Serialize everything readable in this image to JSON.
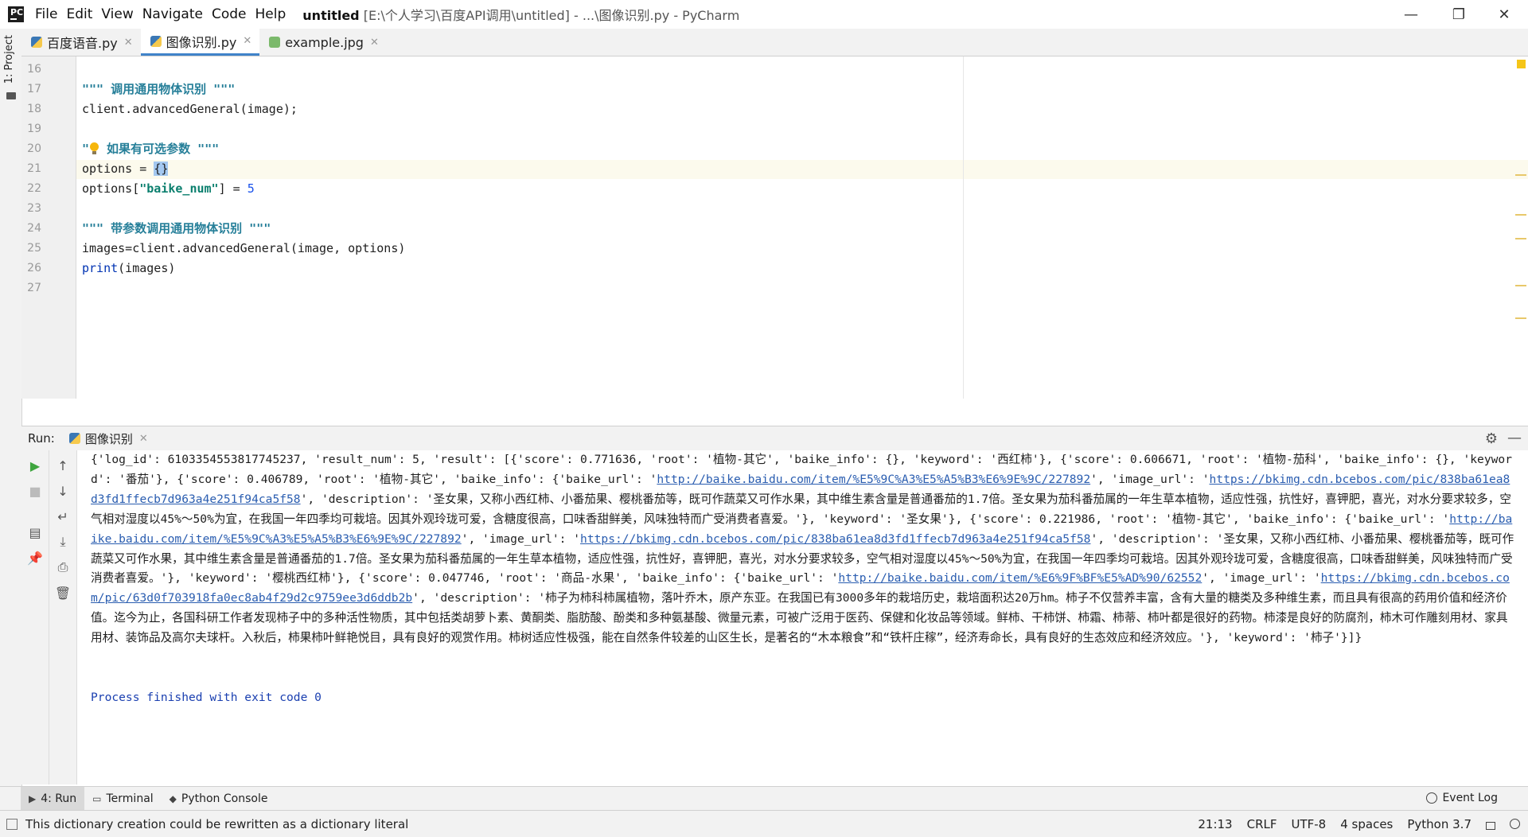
{
  "menu": [
    "File",
    "Edit",
    "View",
    "Navigate",
    "Code",
    "Help"
  ],
  "window_title": {
    "project": "untitled",
    "path": "[E:\\个人学习\\百度API调用\\untitled] - ...\\图像识别.py - PyCharm"
  },
  "window_controls": {
    "minimize": "—",
    "maximize": "❐",
    "close": "✕"
  },
  "left_strip": {
    "project_label": "1: Project"
  },
  "tabs": [
    {
      "label": "百度语音.py"
    },
    {
      "label": "图像识别.py"
    },
    {
      "label": "example.jpg"
    }
  ],
  "editor": {
    "line_numbers": [
      "16",
      "17",
      "18",
      "19",
      "20",
      "21",
      "22",
      "23",
      "24",
      "25",
      "26",
      "27"
    ],
    "lines": {
      "l17": "\"\"\" 调用通用物体识别 \"\"\"",
      "l18": "client.advancedGeneral(image);",
      "l20a": "\"",
      "l20b": " 如果有可选参数 \"\"\"",
      "l21a": "options = ",
      "l21b": "{}",
      "l22a": "options[",
      "l22b": "\"baike_num\"",
      "l22c": "] = ",
      "l22d": "5",
      "l24": "\"\"\" 带参数调用通用物体识别 \"\"\"",
      "l25": "images=client.advancedGeneral(image, options)",
      "l26a": "print",
      "l26b": "(images)"
    }
  },
  "run_panel": {
    "label": "Run:",
    "tab": "图像识别",
    "output": {
      "p1": "{'log_id': 6103354553817745237, 'result_num': 5, 'result': [{'score': 0.771636, 'root': '植物-其它', 'baike_info': {}, 'keyword': '西红柿'}, {'score': 0.606671, 'root': '植物-茄科', 'baike_info': {}, 'keyword': '番茄'}, {'score': 0.406789, 'root': '植物-其它', 'baike_info': {'baike_url': '",
      "link1": "http://baike.baidu.com/item/%E5%9C%A3%E5%A5%B3%E6%9E%9C/227892",
      "p2": "', 'image_url': '",
      "link2": "https://bkimg.cdn.bcebos.com/pic/838ba61ea8d3fd1ffecb7d963a4e251f94ca5f58",
      "p3": "', 'description': '圣女果，又称小西红柿、小番茄果、樱桃番茄等，既可作蔬菜又可作水果，其中维生素含量是普通番茄的1.7倍。圣女果为茄科番茄属的一年生草本植物，适应性强，抗性好，喜钾肥，喜光，对水分要求较多，空气相对湿度以45%～50%为宜，在我国一年四季均可栽培。因其外观玲珑可爱，含糖度很高，口味香甜鲜美，风味独特而广受消费者喜爱。'}, 'keyword': '圣女果'}, {'score': 0.221986, 'root': '植物-其它', 'baike_info': {'baike_url': '",
      "link3": "http://baike.baidu.com/item/%E5%9C%A3%E5%A5%B3%E6%9E%9C/227892",
      "p4": "', 'image_url': '",
      "link4": "https://bkimg.cdn.bcebos.com/pic/838ba61ea8d3fd1ffecb7d963a4e251f94ca5f58",
      "p5": "', 'description': '圣女果，又称小西红柿、小番茄果、樱桃番茄等，既可作蔬菜又可作水果，其中维生素含量是普通番茄的1.7倍。圣女果为茄科番茄属的一年生草本植物，适应性强，抗性好，喜钾肥，喜光，对水分要求较多，空气相对湿度以45%～50%为宜，在我国一年四季均可栽培。因其外观玲珑可爱，含糖度很高，口味香甜鲜美，风味独特而广受消费者喜爱。'}, 'keyword': '樱桃西红柿'}, {'score': 0.047746, 'root': '商品-水果', 'baike_info': {'baike_url': '",
      "link5": "http://baike.baidu.com/item/%E6%9F%BF%E5%AD%90/62552",
      "p6": "', 'image_url': '",
      "link6": "https://bkimg.cdn.bcebos.com/pic/63d0f703918fa0ec8ab4f29d2c9759ee3d6ddb2b",
      "p7": "', 'description': '柿子为柿科柿属植物，落叶乔木，原产东亚。在我国已有3000多年的栽培历史，栽培面积达20万hm。柿子不仅营养丰富，含有大量的糖类及多种维生素，而且具有很高的药用价值和经济价值。迄今为止，各国科研工作者发现柿子中的多种活性物质，其中包括类胡萝卜素、黄酮类、脂肪酸、酚类和多种氨基酸、微量元素，可被广泛用于医药、保健和化妆品等领域。鲜柿、干柿饼、柿霜、柿蒂、柿叶都是很好的药物。柿漆是良好的防腐剂，柿木可作雕刻用材、家具用材、装饰品及高尔夫球杆。入秋后，柿果柿叶鲜艳悦目，具有良好的观赏作用。柿树适应性极强，能在自然条件较差的山区生长，是著名的“木本粮食”和“铁杆庄稼”，经济寿命长，具有良好的生态效应和经济效应。'}, 'keyword': '柿子'}]}",
      "process": "Process finished with exit code 0"
    }
  },
  "tool_tabs": [
    {
      "label": "4: Run"
    },
    {
      "label": "Terminal"
    },
    {
      "label": "Python Console"
    }
  ],
  "event_log": "Event Log",
  "status": {
    "message": "This dictionary creation could be rewritten as a dictionary literal",
    "position": "21:13",
    "line_sep": "CRLF",
    "encoding": "UTF-8",
    "indent": "4 spaces",
    "interpreter": "Python 3.7"
  },
  "colors": {
    "accent": "#4083c9",
    "link": "#2a5db0",
    "process": "#1a3fb0",
    "docstring": "#267f99"
  }
}
